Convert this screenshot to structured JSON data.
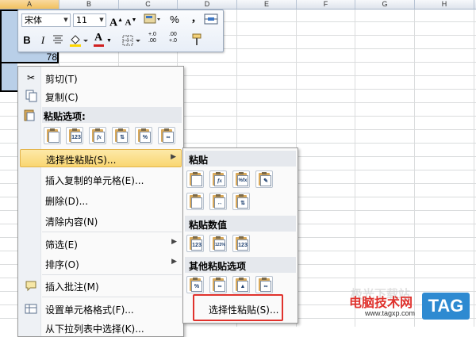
{
  "spreadsheet": {
    "columns": [
      "A",
      "B",
      "C",
      "D",
      "E",
      "F",
      "G",
      "H"
    ],
    "cell_a4_value": "78"
  },
  "mini_toolbar": {
    "font_name": "宋体",
    "font_size": "11",
    "grow_font": "A",
    "shrink_font": "A",
    "percent": "%",
    "comma": ",",
    "bold": "B",
    "italic": "I",
    "font_color_letter": "A",
    "increase_decimal": "+.0\n.00",
    "decrease_decimal": ".00\n+.0",
    "font_color_hex": "#d02020",
    "fill_color_hex": "#ffd700"
  },
  "context_menu": {
    "cut": "剪切(T)",
    "copy": "复制(C)",
    "paste_options_title": "粘贴选项:",
    "paste_special": "选择性粘贴(S)...",
    "insert_copied": "插入复制的单元格(E)...",
    "delete": "删除(D)...",
    "clear": "清除内容(N)",
    "filter": "筛选(E)",
    "sort": "排序(O)",
    "insert_comment": "插入批注(M)",
    "format_cells": "设置单元格格式(F)...",
    "pick_list": "从下拉列表中选择(K)...",
    "paste_option_glyphs": [
      "",
      "123",
      "fx",
      "⇅",
      "%",
      "∞"
    ]
  },
  "submenu": {
    "paste_title": "粘贴",
    "paste_glyphs": [
      "",
      "fx",
      "%fx",
      "✎",
      "",
      "↔",
      "⇅"
    ],
    "paste_values_title": "粘贴数值",
    "paste_values_glyphs": [
      "123",
      "123%",
      "123"
    ],
    "other_title": "其他粘贴选项",
    "other_glyphs": [
      "%",
      "∞",
      "▲",
      "∞"
    ],
    "paste_special_label": "选择性粘贴(S)..."
  },
  "watermark": {
    "site_name": "电脑技术网",
    "faded_text": "极光下载站",
    "url": "www.tagxp.com",
    "tag": "TAG"
  }
}
